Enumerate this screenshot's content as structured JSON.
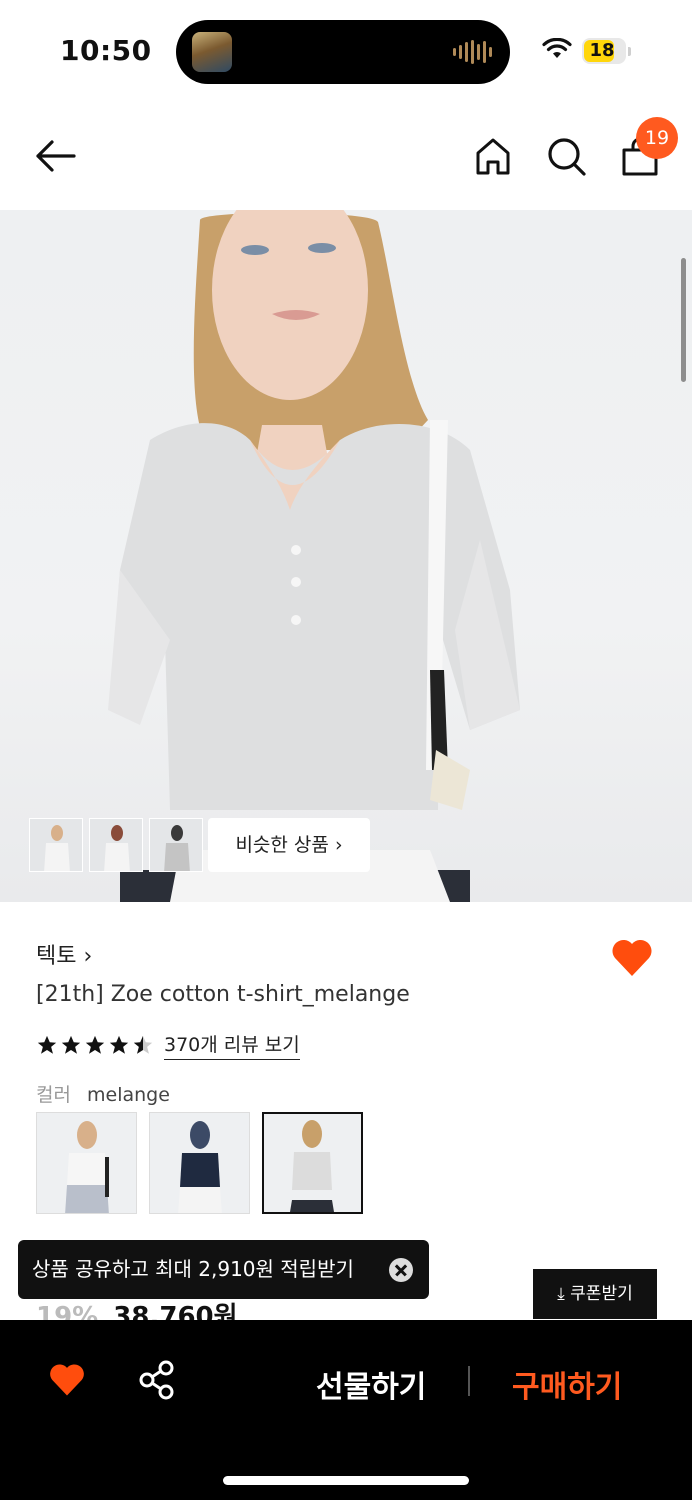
{
  "status_bar": {
    "time": "10:50",
    "battery": "18",
    "wifi_icon": "wifi-icon",
    "battery_color": "#ffd60a"
  },
  "nav": {
    "back_icon": "arrow-left-icon",
    "home_icon": "home-icon",
    "search_icon": "search-icon",
    "cart_icon": "shopping-bag-icon",
    "cart_count": "19",
    "badge_color": "#ff5a1f"
  },
  "hero": {
    "image": "model wearing light grey melange henley t-shirt",
    "similar_label": "비슷한 상품"
  },
  "product": {
    "brand": "텍토",
    "title": "[21th] Zoe cotton t-shirt_melange",
    "rating": 4.5,
    "reviews_label": "370개 리뷰 보기",
    "color_label": "컬러",
    "color_value": "melange",
    "wish_icon": "heart-icon"
  },
  "toast": {
    "text": "상품 공유하고 최대 2,910원 적립받기"
  },
  "price": {
    "discount": "19%",
    "amount": "38,760원"
  },
  "coupon_label": "쿠폰받기",
  "bottom_bar": {
    "gift_label": "선물하기",
    "buy_label": "구매하기",
    "accent_color": "#ff5a1f"
  }
}
